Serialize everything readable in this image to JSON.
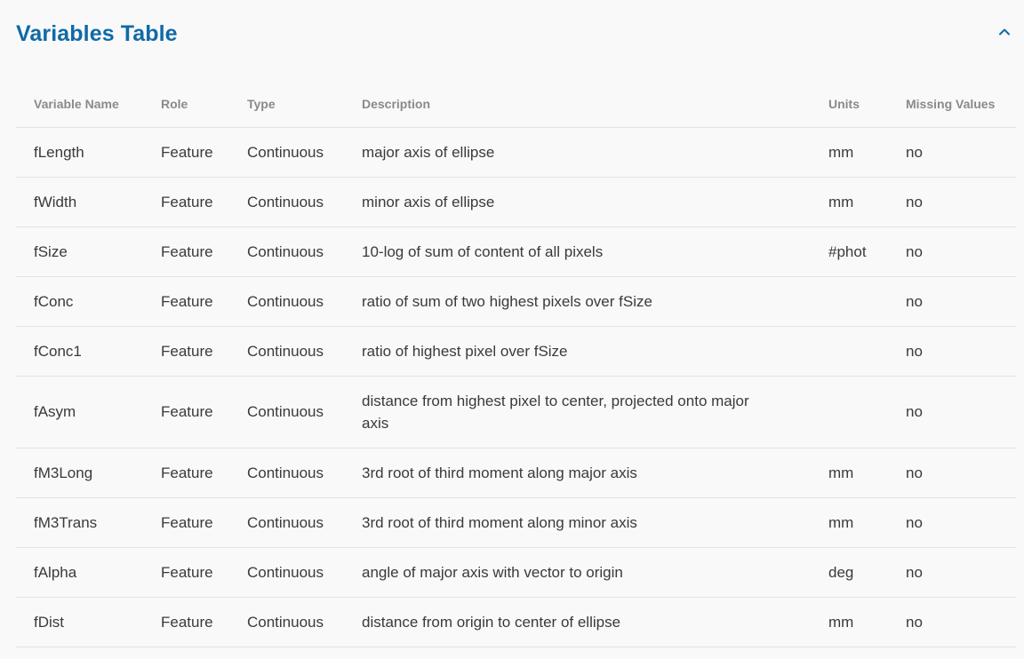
{
  "section": {
    "title": "Variables Table"
  },
  "icons": {
    "collapse": "chevron-up-icon"
  },
  "colors": {
    "accent": "#0f6aa8",
    "header_text": "#8a8a8a",
    "divider": "#e3e3e3",
    "background": "#f9f9f9"
  },
  "table": {
    "headers": [
      "Variable Name",
      "Role",
      "Type",
      "Description",
      "Units",
      "Missing Values"
    ],
    "rows": [
      [
        "fLength",
        "Feature",
        "Continuous",
        "major axis of ellipse",
        "mm",
        "no"
      ],
      [
        "fWidth",
        "Feature",
        "Continuous",
        "minor axis of ellipse",
        "mm",
        "no"
      ],
      [
        "fSize",
        "Feature",
        "Continuous",
        "10-log of sum of content of all pixels",
        "#phot",
        "no"
      ],
      [
        "fConc",
        "Feature",
        "Continuous",
        "ratio of sum of two highest pixels over fSize",
        "",
        "no"
      ],
      [
        "fConc1",
        "Feature",
        "Continuous",
        "ratio of highest pixel over fSize",
        "",
        "no"
      ],
      [
        "fAsym",
        "Feature",
        "Continuous",
        "distance from highest pixel to center, projected onto major axis",
        "",
        "no"
      ],
      [
        "fM3Long",
        "Feature",
        "Continuous",
        "3rd root of third moment along major axis",
        "mm",
        "no"
      ],
      [
        "fM3Trans",
        "Feature",
        "Continuous",
        "3rd root of third moment along minor axis",
        "mm",
        "no"
      ],
      [
        "fAlpha",
        "Feature",
        "Continuous",
        "angle of major axis with vector to origin",
        "deg",
        "no"
      ],
      [
        "fDist",
        "Feature",
        "Continuous",
        "distance from origin to center of ellipse",
        "mm",
        "no"
      ]
    ]
  }
}
